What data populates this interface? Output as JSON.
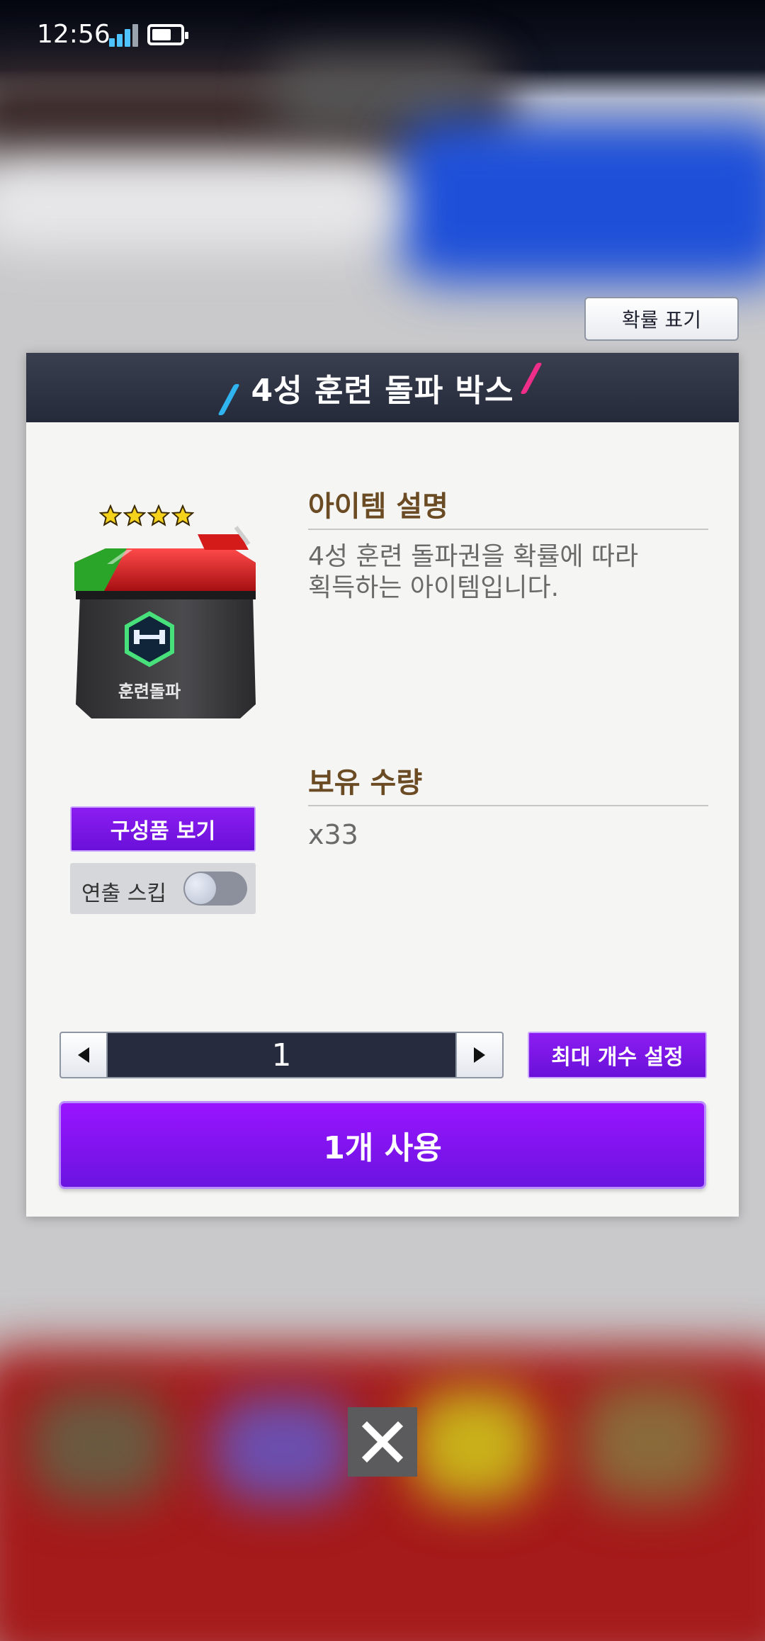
{
  "status_bar": {
    "time": "12:56"
  },
  "probability_button": "확률 표기",
  "dialog": {
    "title": "4성 훈련 돌파 박스",
    "item_label": "훈련돌파",
    "star_count": 4,
    "compose_button": "구성품 보기",
    "skip_label": "연출 스킵",
    "skip_enabled": false,
    "desc_title": "아이템 설명",
    "description_line1": "4성 훈련 돌파권을 확률에 따라",
    "description_line2": "획득하는 아이템입니다.",
    "owned_title": "보유 수량",
    "owned_quantity": "x33",
    "stepper_value": "1",
    "max_button": "최대 개수 설정",
    "use_button": "1개 사용"
  },
  "colors": {
    "header": "#252a3a",
    "purple_button": "#7a14e8",
    "section_title": "#6b4b23",
    "accent_blue": "#2fb4f0",
    "accent_pink": "#ef2e89"
  },
  "icons": [
    "signal-icon",
    "battery-icon",
    "star-icon",
    "chevron-left-icon",
    "chevron-right-icon",
    "close-icon"
  ]
}
